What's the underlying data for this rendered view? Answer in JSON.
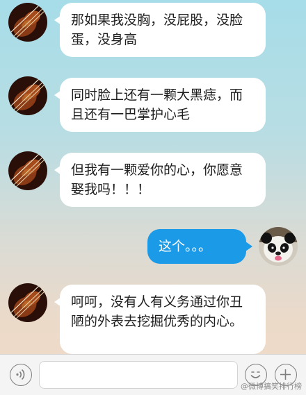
{
  "messages": [
    {
      "side": "in",
      "text": "那如果我没胸，没屁股，没脸蛋，没身高"
    },
    {
      "side": "in",
      "text": "同时脸上还有一颗大黑痣，而且还有一巴掌护心毛"
    },
    {
      "side": "in",
      "text": "但我有一颗爱你的心，你愿意娶我吗！！！"
    },
    {
      "side": "out",
      "text": "这个。。。"
    },
    {
      "side": "in",
      "text": "呵呵，没有人有义务通过你丑陋的外表去挖掘优秀的内心。"
    }
  ],
  "input_bar": {
    "message_value": "",
    "voice_icon": "voice-icon",
    "emoji_icon": "emoji-icon",
    "plus_icon": "plus-icon"
  },
  "watermark": "@微博搞笑排行榜",
  "colors": {
    "outgoing_bubble": "#1b9ae8",
    "incoming_bubble": "#ffffff"
  }
}
